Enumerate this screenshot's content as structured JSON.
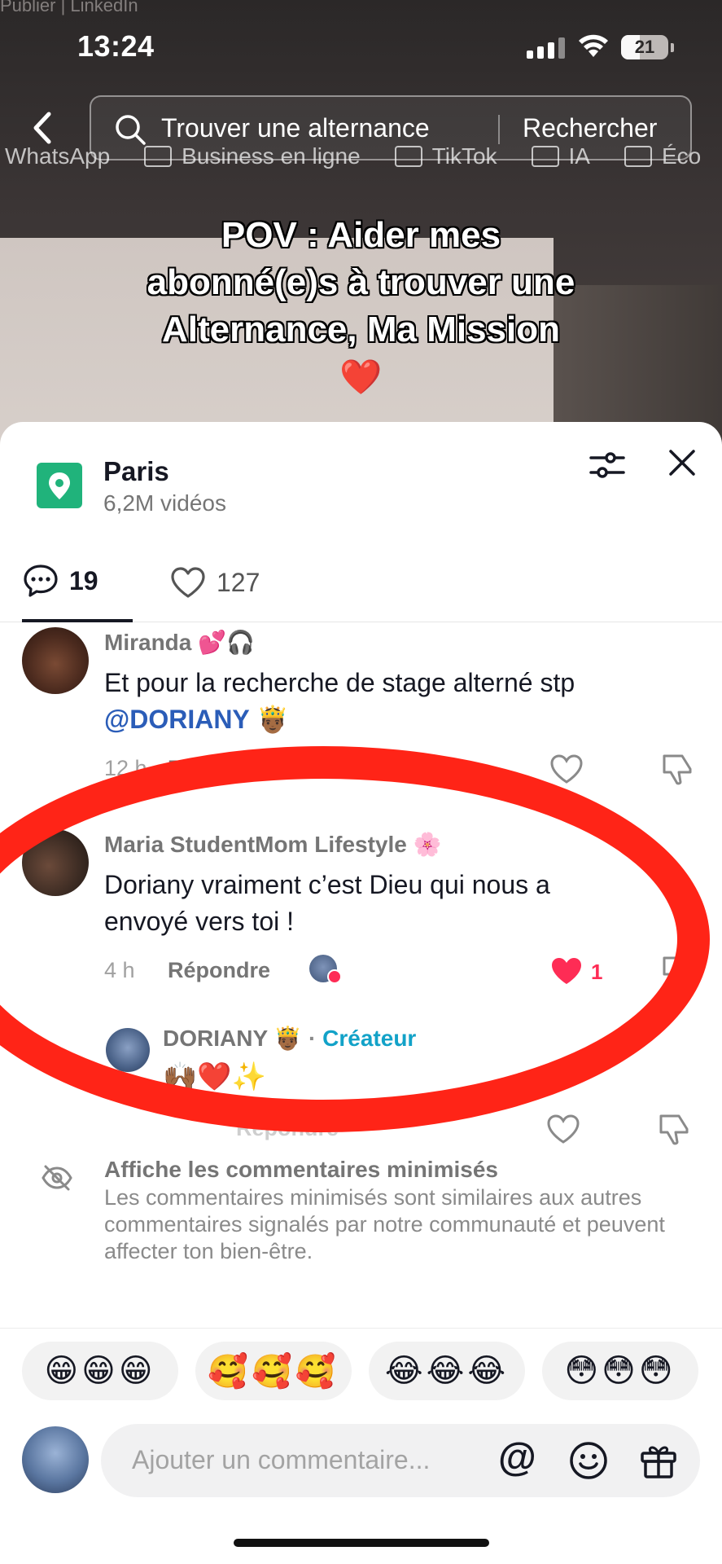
{
  "status_bar": {
    "time": "13:24",
    "battery": "21"
  },
  "background": {
    "top_text": "Publier | LinkedIn"
  },
  "search": {
    "query": "Trouver une alternance",
    "button_label": "Rechercher"
  },
  "bookmarks": [
    "WhatsApp",
    "Business en ligne",
    "TikTok",
    "IA",
    "Éco"
  ],
  "caption": {
    "line1": "POV : Aider mes",
    "line2": "abonné(e)s à trouver une",
    "line3": "Alternance, Ma Mission",
    "emoji": "❤️"
  },
  "sheet": {
    "place_title": "Paris",
    "place_subtitle": "6,2M vidéos",
    "tabs": {
      "comments_count": "19",
      "likes_count": "127"
    }
  },
  "comments": [
    {
      "name": "Miranda 💕🎧",
      "text": "Et pour la recherche de stage alterné stp",
      "mention": "@DORIANY 🤴🏾",
      "time": "12 h",
      "reply_label": "Répondre"
    },
    {
      "name": "Maria StudentMom Lifestyle 🌸",
      "text": "Doriany vraiment c’est Dieu qui nous a envoyé vers toi !",
      "time": "4 h",
      "reply_label": "Répondre",
      "likes": "1"
    }
  ],
  "creator_reply": {
    "name": "DORIANY 🤴🏾",
    "separator": "·",
    "badge": "Créateur",
    "text": "🙌🏾❤️✨",
    "reply_label": "Répondre"
  },
  "minimized": {
    "title": "Affiche les commentaires minimisés",
    "description": "Les commentaires minimisés sont similaires aux autres commentaires signalés par notre communauté et peuvent affecter ton bien-être."
  },
  "quick_emojis": [
    "😁😁😁",
    "🥰🥰🥰",
    "😂😂😂",
    "😳😳😳"
  ],
  "composer": {
    "placeholder": "Ajouter un commentaire...",
    "at_symbol": "@"
  },
  "colors": {
    "accent_red": "#fe2c55",
    "creator_blue": "#12a2c8",
    "place_green": "#20b37b",
    "annotation_red": "#ff2417"
  }
}
